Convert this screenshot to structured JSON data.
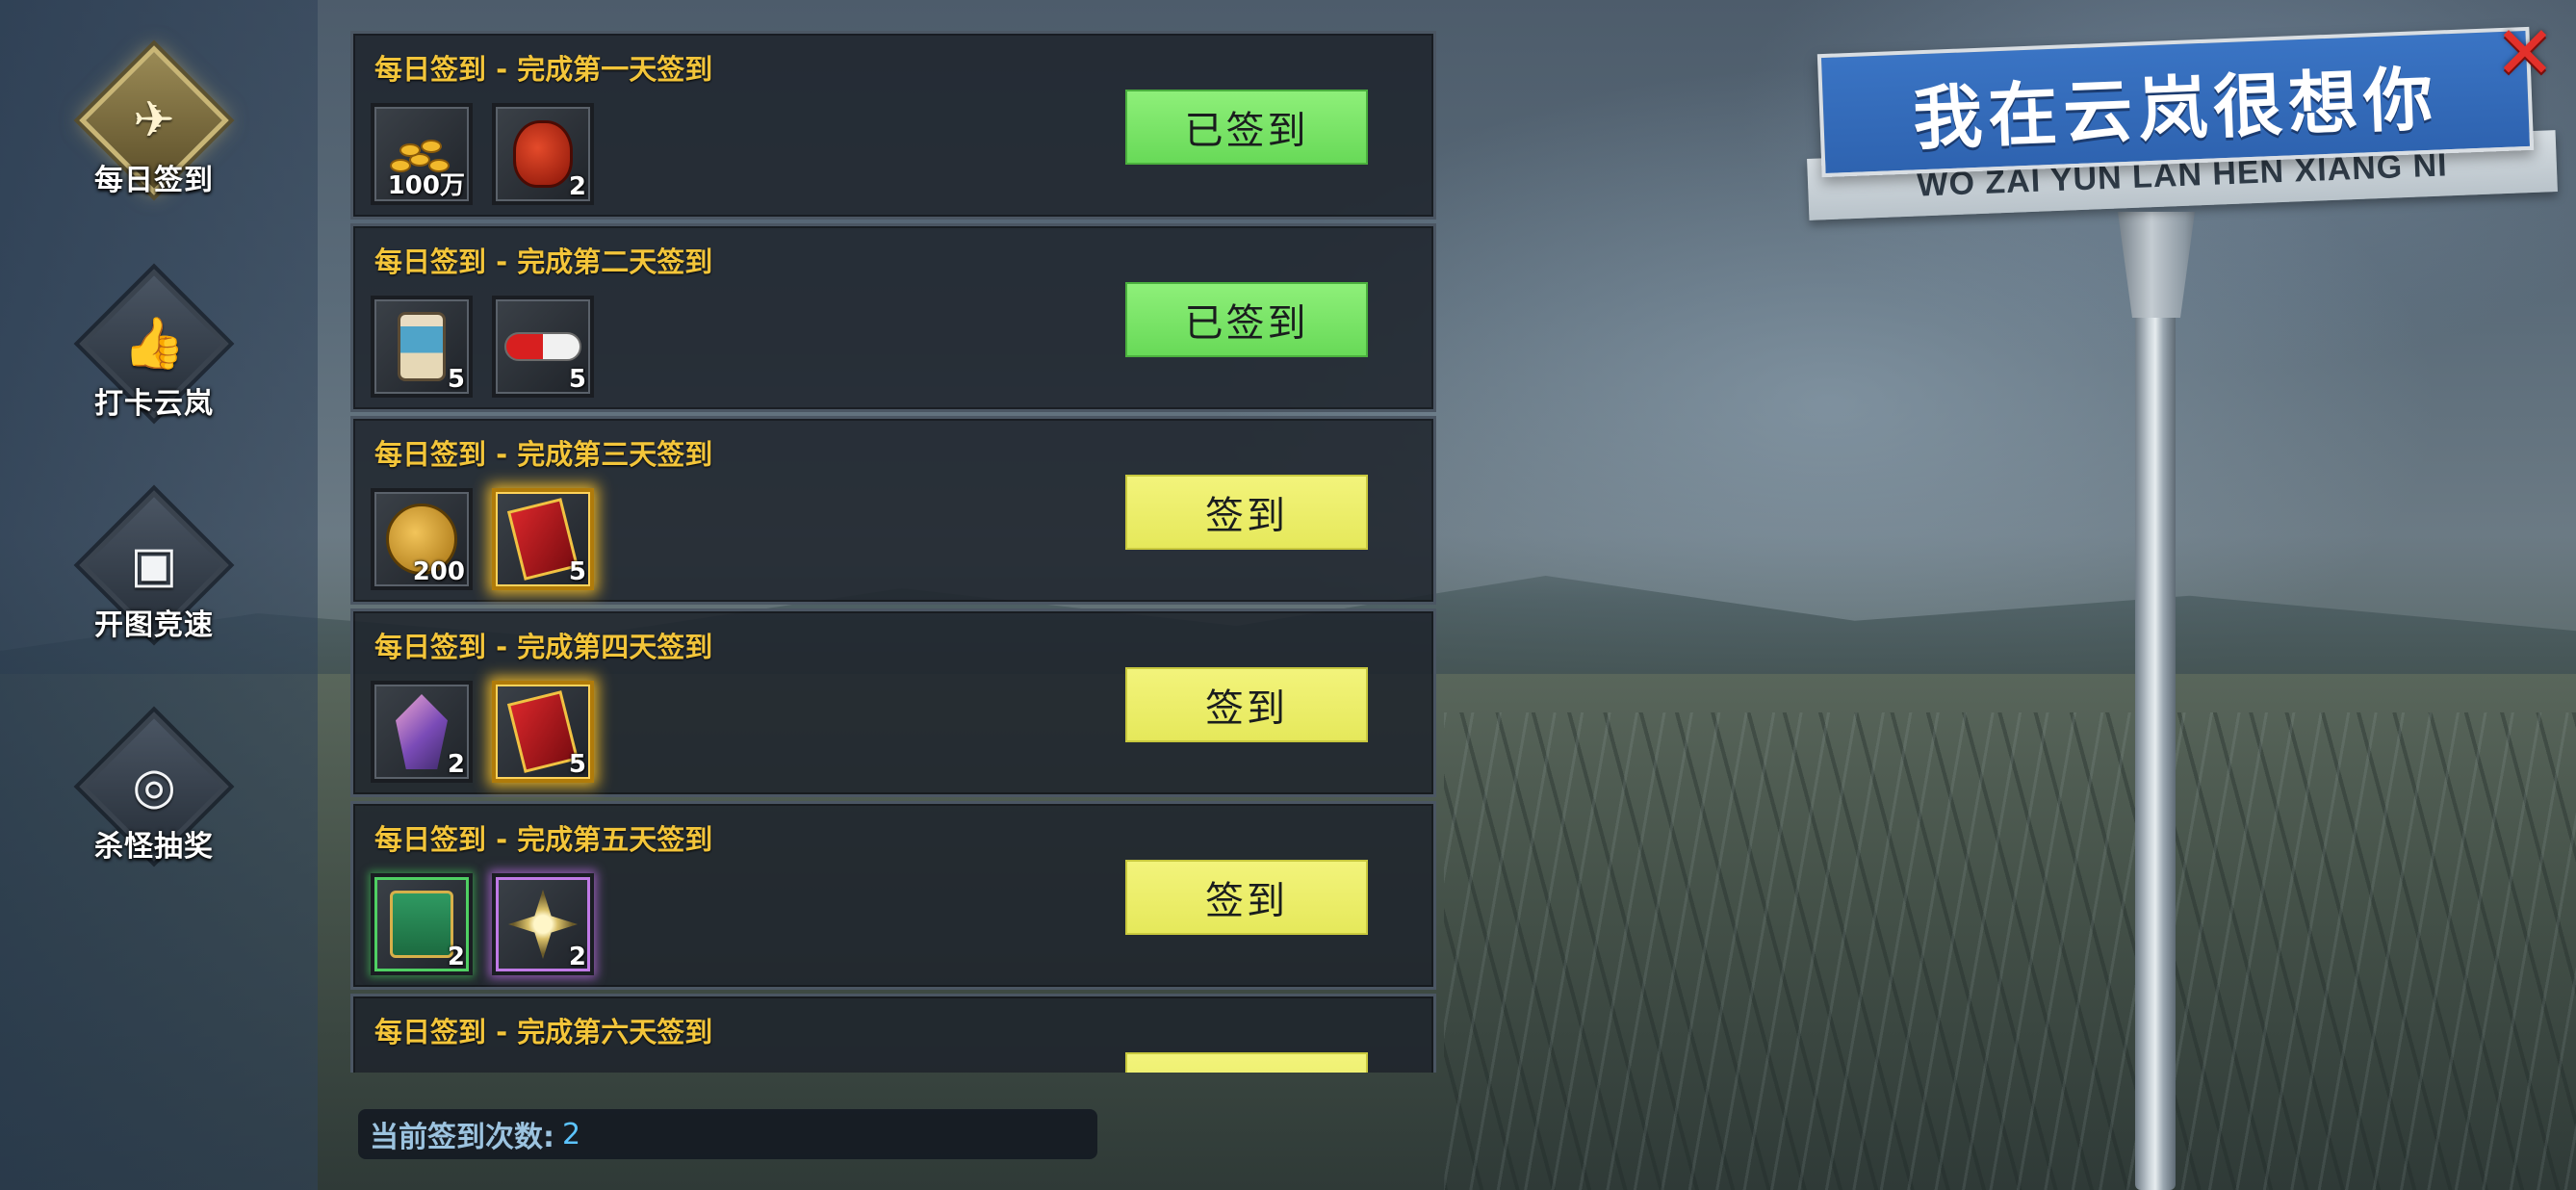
{
  "sign": {
    "title": "我在云岚很想你",
    "subtitle": "WO ZAI YUN LAN HEN XIANG NI"
  },
  "close": {
    "glyph": "✕",
    "icon": "close-icon",
    "color": "#e3302a"
  },
  "nav": [
    {
      "label": "每日签到",
      "icon": "paper-plane-icon",
      "glyph": "✈",
      "active": true
    },
    {
      "label": "打卡云岚",
      "icon": "thumbs-up-icon",
      "glyph": "👍",
      "active": false
    },
    {
      "label": "开图竞速",
      "icon": "picture-icon",
      "glyph": "▣",
      "active": false
    },
    {
      "label": "杀怪抽奖",
      "icon": "scroll-icon",
      "glyph": "◎",
      "active": false
    }
  ],
  "rows": [
    {
      "title": "每日签到 - 完成第一天签到",
      "items": [
        {
          "icon": "gold-coins-icon",
          "qty": "100万",
          "style": ""
        },
        {
          "icon": "red-bag-icon",
          "qty": "2",
          "style": ""
        }
      ],
      "button": "已签到",
      "status": "done"
    },
    {
      "title": "每日签到 - 完成第二天签到",
      "items": [
        {
          "icon": "cup-icon",
          "qty": "5",
          "style": ""
        },
        {
          "icon": "pill-icon",
          "qty": "5",
          "style": ""
        }
      ],
      "button": "已签到",
      "status": "done"
    },
    {
      "title": "每日签到 - 完成第三天签到",
      "items": [
        {
          "icon": "coin-icon",
          "qty": "200",
          "style": ""
        },
        {
          "icon": "red-book-icon",
          "qty": "5",
          "style": "glow"
        }
      ],
      "button": "签到",
      "status": "todo"
    },
    {
      "title": "每日签到 - 完成第四天签到",
      "items": [
        {
          "icon": "crystal-icon",
          "qty": "2",
          "style": ""
        },
        {
          "icon": "red-book-icon",
          "qty": "5",
          "style": "glow"
        }
      ],
      "button": "签到",
      "status": "todo"
    },
    {
      "title": "每日签到 - 完成第五天签到",
      "items": [
        {
          "icon": "gift-box-icon",
          "qty": "2",
          "style": "glow-green"
        },
        {
          "icon": "star-shard-icon",
          "qty": "2",
          "style": "glow-purple"
        }
      ],
      "button": "签到",
      "status": "todo"
    },
    {
      "title": "每日签到 - 完成第六天签到",
      "items": [],
      "button": "",
      "status": "todo"
    }
  ],
  "counter": {
    "label": "当前签到次数:",
    "value": "2"
  },
  "colors": {
    "title_gold": "#f3c53a",
    "done_green": "#7ce86a",
    "todo_yellow": "#eced6a",
    "sign_blue": "#3a74c4"
  }
}
